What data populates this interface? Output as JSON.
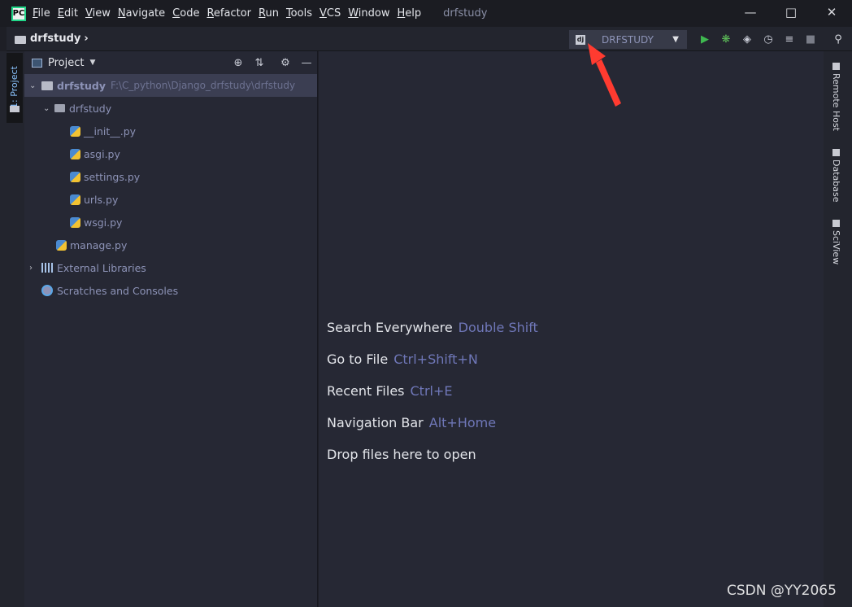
{
  "titlebar": {
    "logo": "PC",
    "menu": [
      "File",
      "Edit",
      "View",
      "Navigate",
      "Code",
      "Refactor",
      "Run",
      "Tools",
      "VCS",
      "Window",
      "Help"
    ],
    "window_title": "drfstudy"
  },
  "navbar": {
    "breadcrumb": "drfstudy",
    "run_config": "DRFSTUDY",
    "run_config_icon": "dj"
  },
  "left_toolwindow": {
    "tab_label": "1: Project"
  },
  "project_panel": {
    "title": "Project",
    "tree": [
      {
        "label": "drfstudy",
        "path": "F:\\C_python\\Django_drfstudy\\drfstudy"
      },
      {
        "label": "drfstudy"
      },
      {
        "label": "__init__.py"
      },
      {
        "label": "asgi.py"
      },
      {
        "label": "settings.py"
      },
      {
        "label": "urls.py"
      },
      {
        "label": "wsgi.py"
      },
      {
        "label": "manage.py"
      },
      {
        "label": "External Libraries"
      },
      {
        "label": "Scratches and Consoles"
      }
    ]
  },
  "editor": {
    "tips": [
      {
        "label": "Search Everywhere",
        "key": "Double Shift"
      },
      {
        "label": "Go to File",
        "key": "Ctrl+Shift+N"
      },
      {
        "label": "Recent Files",
        "key": "Ctrl+E"
      },
      {
        "label": "Navigation Bar",
        "key": "Alt+Home"
      },
      {
        "label": "Drop files here to open",
        "key": ""
      }
    ]
  },
  "right_toolwindow": {
    "tabs": [
      "Remote Host",
      "Database",
      "SciView"
    ]
  },
  "watermark": "CSDN @YY2065",
  "colors": {
    "background": "#262834",
    "key_hint": "#6f77b8",
    "tree_text": "#8d93b7",
    "annotation_arrow": "#ff3b30"
  }
}
